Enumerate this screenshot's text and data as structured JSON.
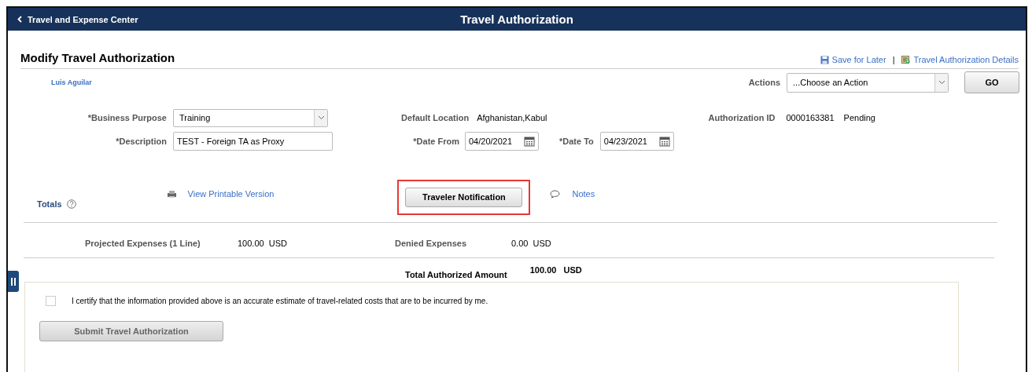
{
  "header": {
    "back_link": "Travel and Expense Center",
    "title": "Travel Authorization"
  },
  "page_title": "Modify Travel Authorization",
  "top_links": [
    {
      "kind": "save",
      "label": "Save for Later"
    },
    {
      "kind": "details",
      "label": "Travel Authorization Details"
    }
  ],
  "link_separator": "|",
  "traveler": "Luis Aguilar",
  "actions": {
    "label": "Actions",
    "value": "...Choose an Action",
    "go": "GO"
  },
  "form": {
    "business_purpose": {
      "label": "*Business Purpose",
      "value": "Training"
    },
    "description": {
      "label": "*Description",
      "value": "TEST - Foreign TA as Proxy"
    },
    "default_location": {
      "label": "Default Location",
      "value": "Afghanistan,Kabul"
    },
    "date_from": {
      "label": "*Date From",
      "value": "04/20/2021"
    },
    "date_to": {
      "label": "*Date To",
      "value": "04/23/2021"
    },
    "authorization_id": {
      "label": "Authorization ID",
      "value": "0000163381",
      "status": "Pending"
    }
  },
  "totals_label": "Totals",
  "printable_link": "View Printable Version",
  "notification_button": {
    "label": "Traveler Notification",
    "highlighted": true
  },
  "notes_link": "Notes",
  "expenses": [
    {
      "label": "Projected Expenses (1 Line)",
      "amount": "100.00",
      "currency": "USD"
    },
    {
      "label": "Denied Expenses",
      "amount": "0.00",
      "currency": "USD"
    }
  ],
  "total_authorized": {
    "label": "Total Authorized Amount",
    "amount": "100.00",
    "currency": "USD"
  },
  "certify": {
    "text": "I certify that the information provided above is an accurate estimate of travel-related costs that are to be incurred by me.",
    "checked": false
  },
  "submit": {
    "label": "Submit Travel Authorization",
    "disabled": true
  }
}
